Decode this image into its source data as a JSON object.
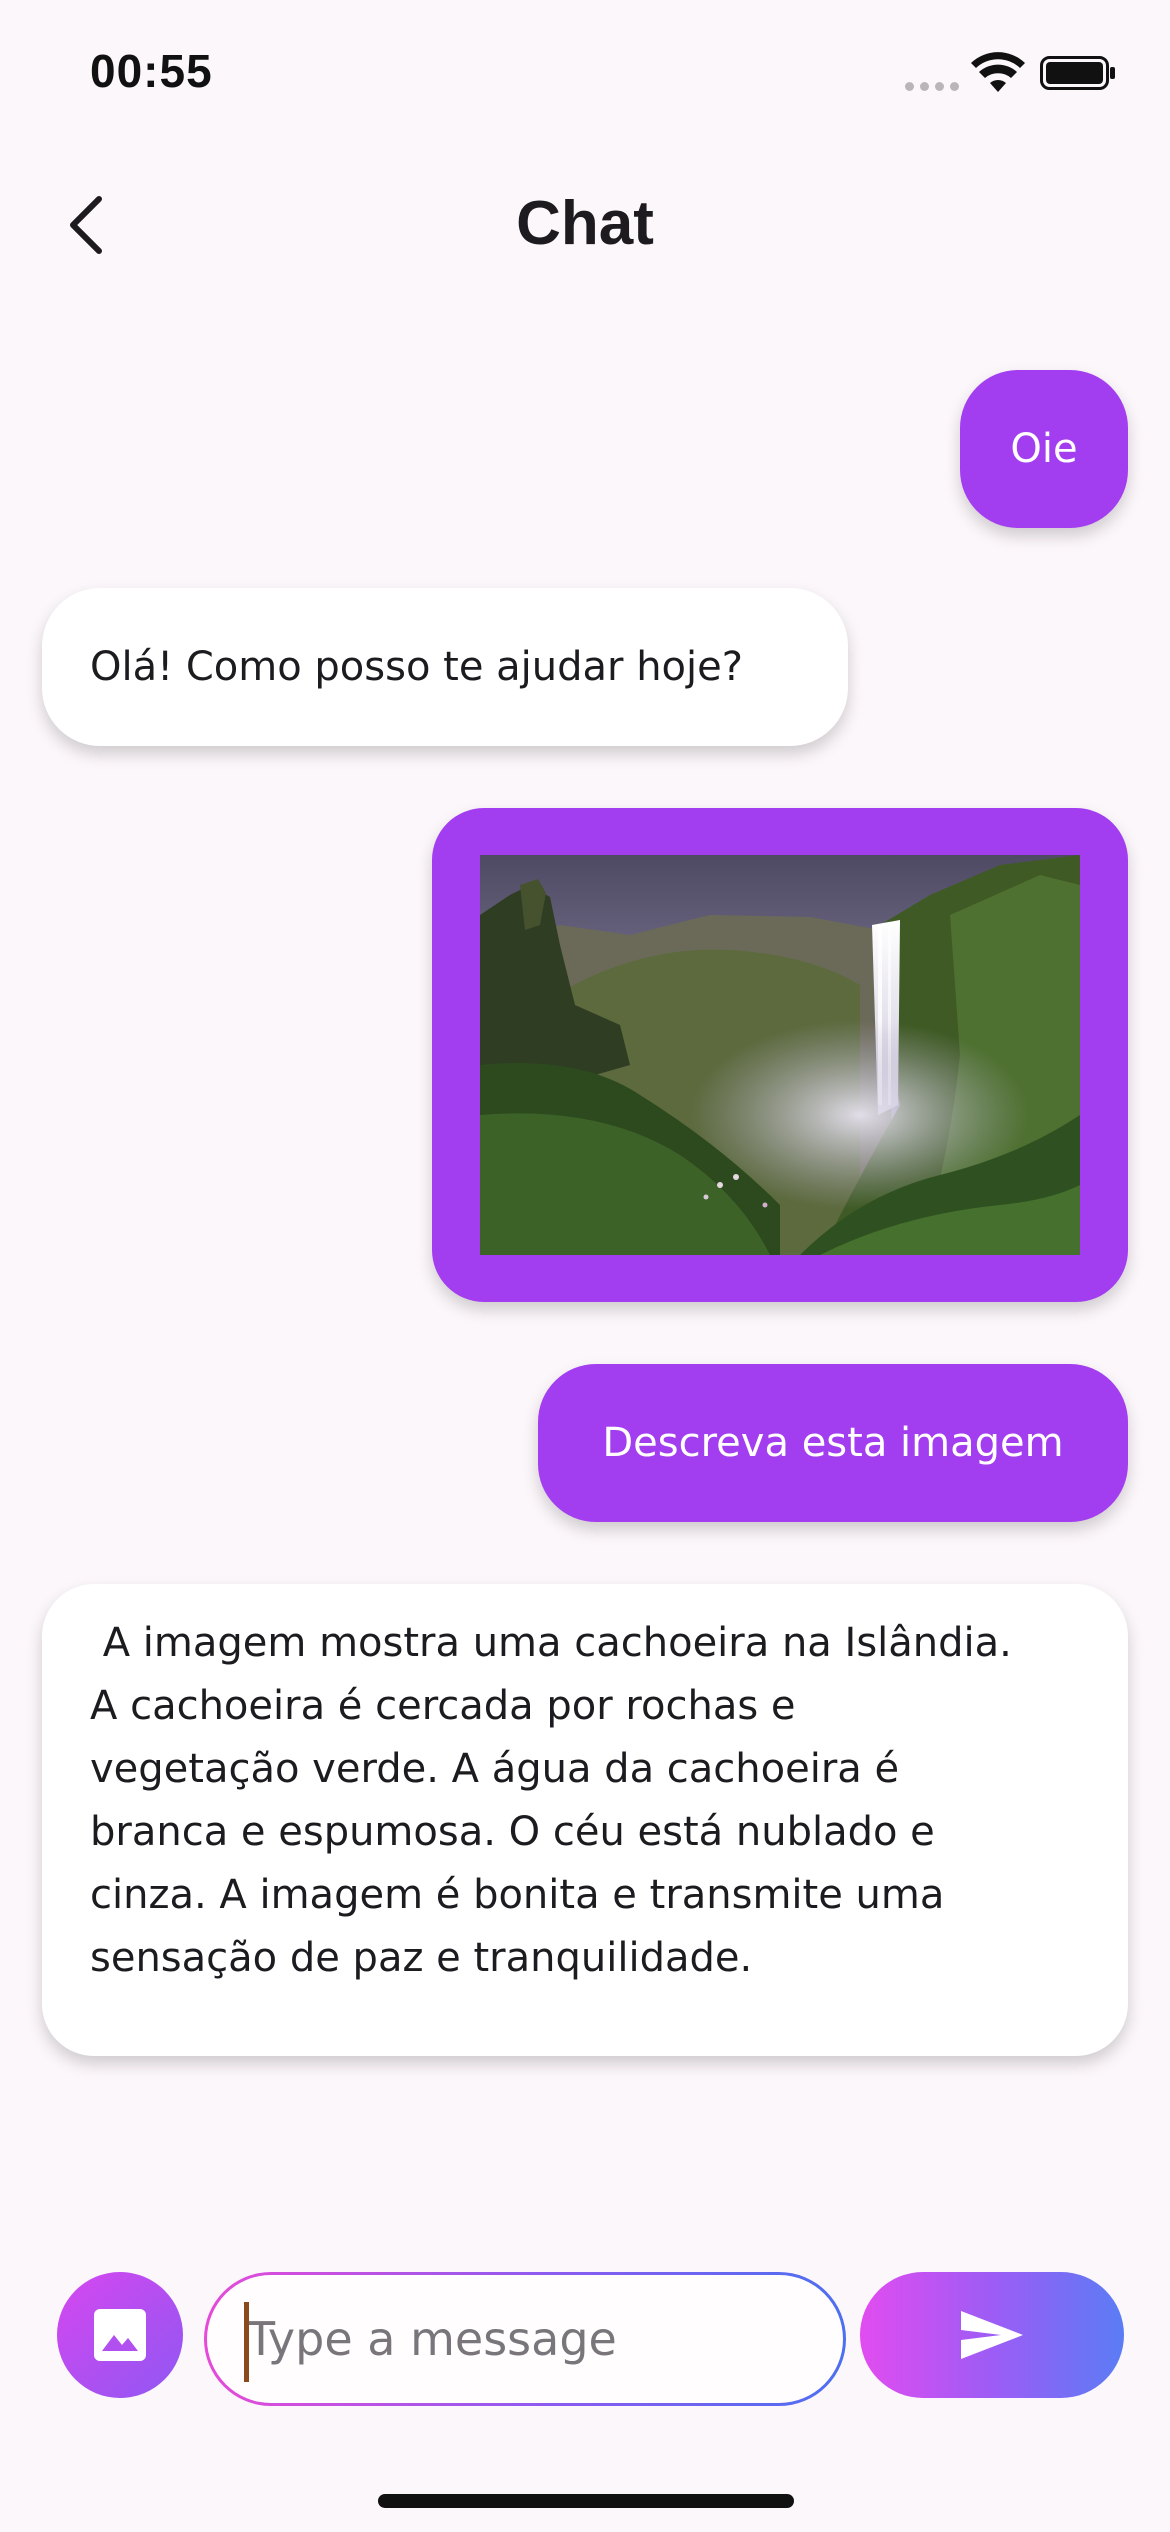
{
  "status_bar": {
    "time": "00:55"
  },
  "header": {
    "title": "Chat"
  },
  "messages": [
    {
      "role": "user",
      "text": "Oie"
    },
    {
      "role": "assistant",
      "text": "Olá! Como posso te ajudar hoje?"
    },
    {
      "role": "user",
      "type": "image"
    },
    {
      "role": "user",
      "text": "Descreva esta imagem"
    },
    {
      "role": "assistant",
      "text": " A imagem mostra uma cachoeira na Islândia.\nA cachoeira é cercada por rochas e\nvegetação verde. A água da cachoeira é\nbranca e espumosa. O céu está nublado e\ncinza. A imagem é bonita e transmite uma\nsensação de paz e tranquilidade."
    }
  ],
  "composer": {
    "placeholder": "Type a message",
    "value": ""
  },
  "icons": {
    "back": "chevron-left-icon",
    "attach": "image-icon",
    "send": "send-icon"
  },
  "colors": {
    "user_bubble": "#a23ef0",
    "assistant_bubble": "#ffffff",
    "background": "#fcf7fb",
    "gradient_start": "#e24cf0",
    "gradient_end": "#5a7cf5"
  }
}
